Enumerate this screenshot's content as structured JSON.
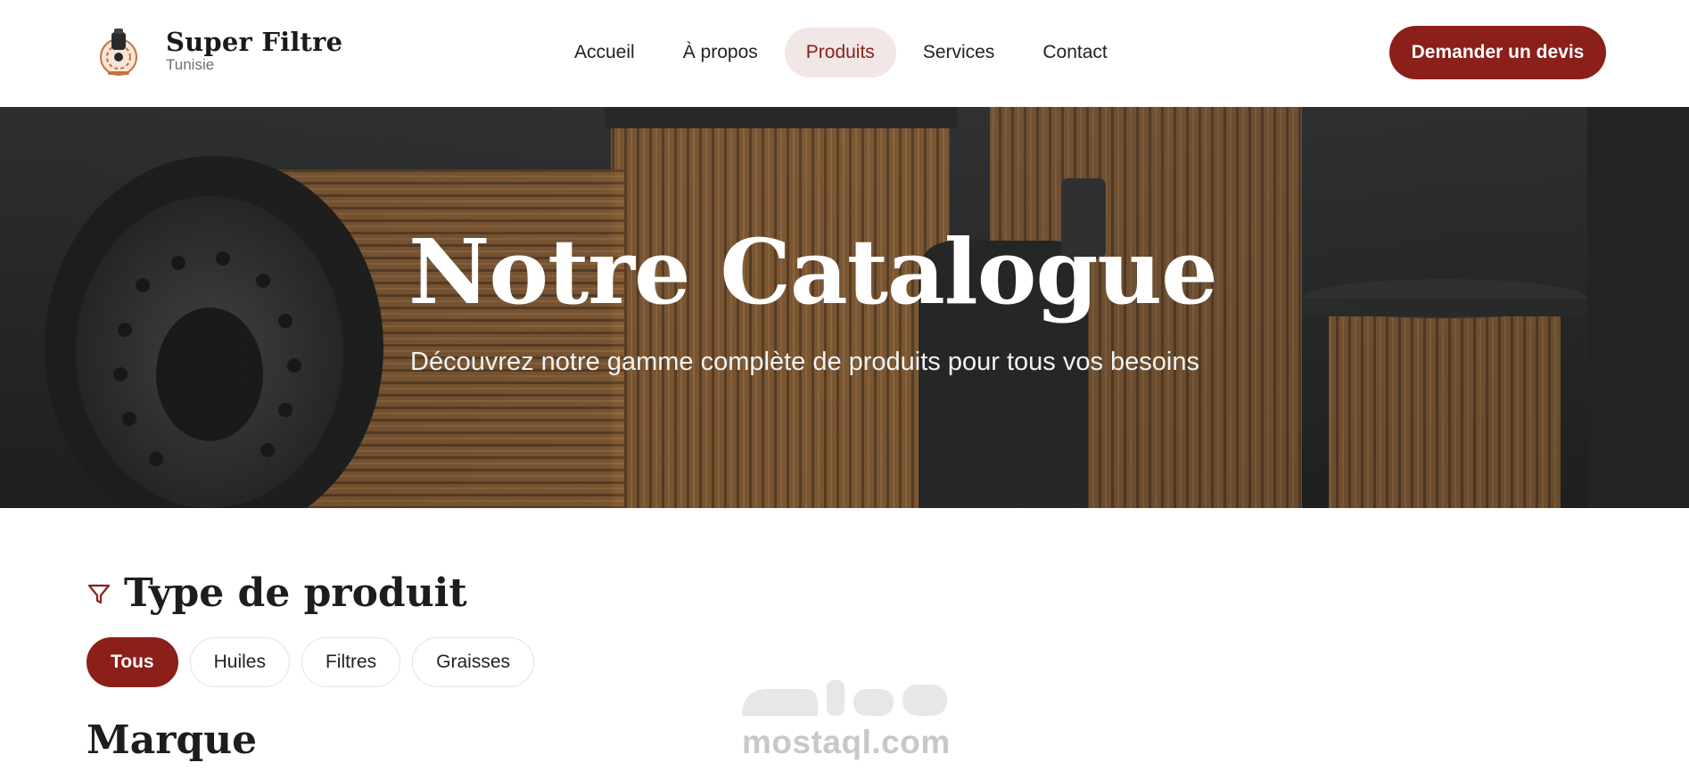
{
  "brand": {
    "name": "Super Filtre",
    "tagline": "Tunisie"
  },
  "nav": {
    "items": [
      {
        "label": "Accueil",
        "active": false
      },
      {
        "label": "À propos",
        "active": false
      },
      {
        "label": "Produits",
        "active": true
      },
      {
        "label": "Services",
        "active": false
      },
      {
        "label": "Contact",
        "active": false
      }
    ]
  },
  "cta": {
    "label": "Demander un devis"
  },
  "hero": {
    "title": "Notre Catalogue",
    "subtitle": "Découvrez notre gamme complète de produits pour tous vos besoins"
  },
  "filters": {
    "type_title": "Type de produit",
    "chips": [
      {
        "label": "Tous",
        "active": true
      },
      {
        "label": "Huiles",
        "active": false
      },
      {
        "label": "Filtres",
        "active": false
      },
      {
        "label": "Graisses",
        "active": false
      }
    ],
    "brand_title": "Marque"
  },
  "watermark": {
    "text": "mostaql.com",
    "arabic": "مستقل"
  },
  "colors": {
    "accent": "#8b1f19",
    "active_nav_bg": "#f1e7e6"
  },
  "icons": {
    "filter": "funnel-icon",
    "logo": "super-filtre-logo"
  }
}
